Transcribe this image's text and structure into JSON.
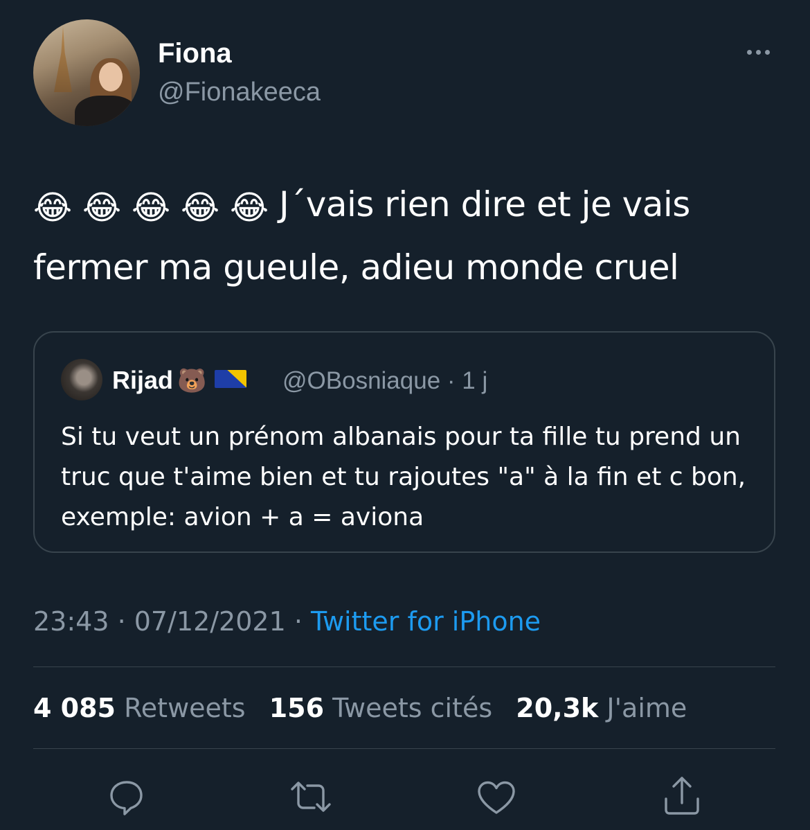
{
  "author": {
    "name": "Fiona",
    "handle": "@Fionakeeca"
  },
  "tweet": {
    "emojis": [
      "😂",
      "😂",
      "😂",
      "😂",
      "😂"
    ],
    "text": "J´vais rien dire et je vais fermer ma gueule, adieu monde cruel"
  },
  "quoted_tweet": {
    "name": "Rijad",
    "name_emoji": "🐻",
    "flag_icon": "bosnia-flag-icon",
    "handle_time": "@OBosniaque · 1 j",
    "text": "Si tu veut un prénom albanais pour ta fille tu prend un truc que t'aime bien et tu rajoutes \"a\" à la fin et c bon, exemple: avion + a = aviona"
  },
  "meta": {
    "time_date": "23:43 · 07/12/2021 · ",
    "source": "Twitter for iPhone"
  },
  "stats": {
    "retweets_count": "4 085",
    "retweets_label": "Retweets",
    "quotes_count": "156",
    "quotes_label": "Tweets cités",
    "likes_count": "20,3k",
    "likes_label": "J'aime"
  },
  "actions": [
    "reply-icon",
    "retweet-icon",
    "like-icon",
    "share-icon"
  ],
  "colors": {
    "background": "#15202b",
    "accent": "#1d9bf0",
    "secondary_text": "#8b98a5",
    "border": "#38444d"
  }
}
